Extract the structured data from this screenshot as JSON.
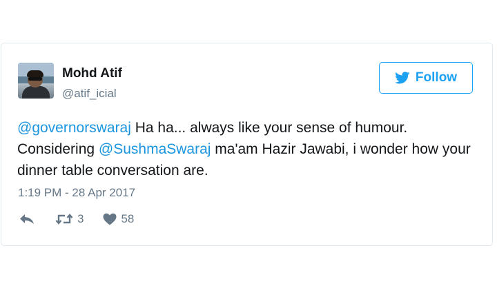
{
  "tweet": {
    "author_name": "Mohd Atif",
    "author_handle": "@atif_icial",
    "follow_label": "Follow",
    "text_parts": {
      "mention1": "@governorswaraj",
      "part1": " Ha ha... always like your sense of humour. Considering ",
      "mention2": "@SushmaSwaraj",
      "part2": " ma'am Hazir Jawabi, i wonder how your dinner table conversation are."
    },
    "timestamp": "1:19 PM - 28 Apr 2017",
    "retweet_count": "3",
    "like_count": "58"
  },
  "icons": {
    "follow": "twitter-bird-icon",
    "reply": "reply-arrow-icon",
    "retweet": "retweet-icon",
    "like": "heart-icon"
  },
  "colors": {
    "accent": "#1da1f2",
    "mention": "#1b95e0",
    "muted": "#657786",
    "text": "#14171a",
    "border": "#e1e8ed"
  }
}
